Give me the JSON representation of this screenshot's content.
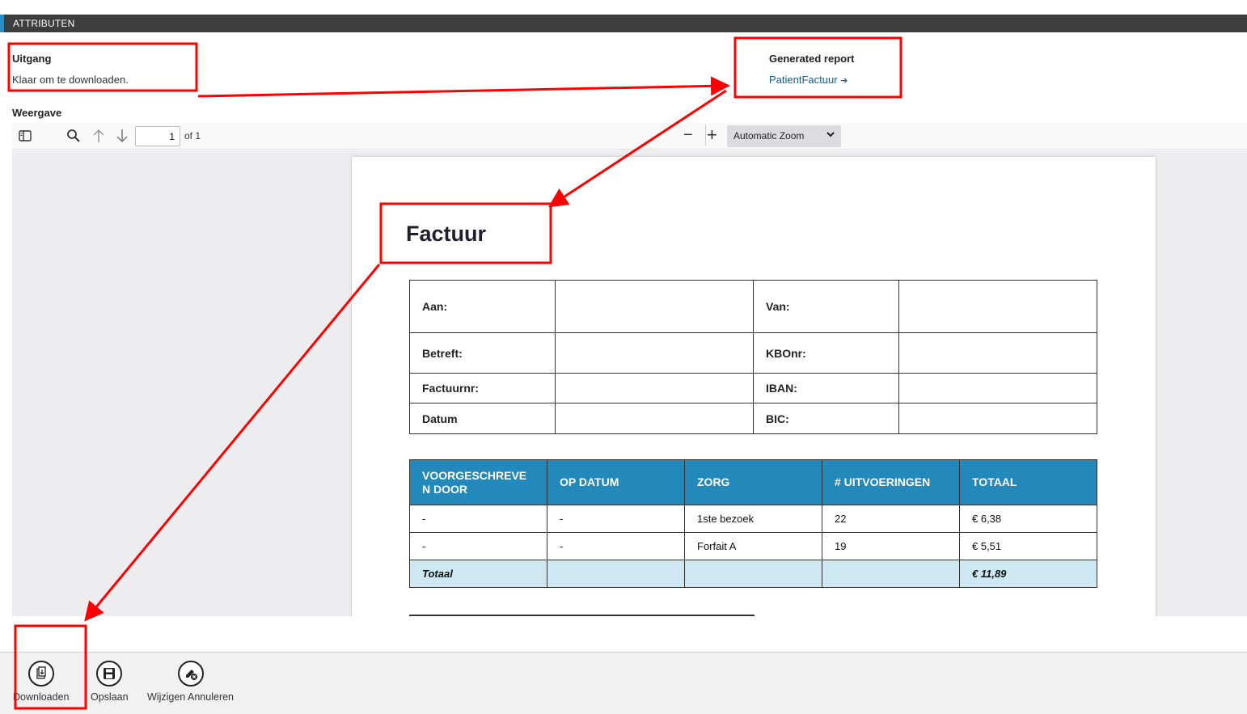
{
  "header": {
    "title": "ATTRIBUTEN"
  },
  "output": {
    "label": "Uitgang",
    "status": "Klaar om te downloaden."
  },
  "report": {
    "label": "Generated report",
    "link": "PatientFactuur",
    "link_arrow": "➔"
  },
  "view": {
    "label": "Weergave"
  },
  "toolbar": {
    "page": "1",
    "of": "of 1",
    "zoom": "Automatic Zoom",
    "zoom_out": "−",
    "zoom_in": "+"
  },
  "document": {
    "title": "Factuur",
    "info_rows": [
      {
        "left_label": "Aan:",
        "right_label": "Van:"
      },
      {
        "left_label": "Betreft:",
        "right_label": "KBOnr:"
      },
      {
        "left_label": "Factuurnr:",
        "right_label": "IBAN:"
      },
      {
        "left_label": "Datum",
        "right_label": "BIC:"
      }
    ],
    "columns": [
      "VOORGESCHREVE N DOOR",
      "OP DATUM",
      "ZORG",
      "# UITVOERINGEN",
      "TOTAAL"
    ],
    "rows": [
      [
        "-",
        "-",
        "1ste bezoek",
        "22",
        "€ 6,38"
      ],
      [
        "-",
        "-",
        "Forfait A",
        "19",
        "€ 5,51"
      ]
    ],
    "total": {
      "label": "Totaal",
      "value": "€ 11,89"
    }
  },
  "actions": [
    {
      "label": "Downloaden",
      "icon": "download-icon"
    },
    {
      "label": "Opslaan",
      "icon": "save-icon"
    },
    {
      "label": "Wijzigen Annuleren",
      "icon": "cancel-edit-icon"
    }
  ],
  "annotation_color": "#ff0000",
  "accent_color": "#2389bb"
}
